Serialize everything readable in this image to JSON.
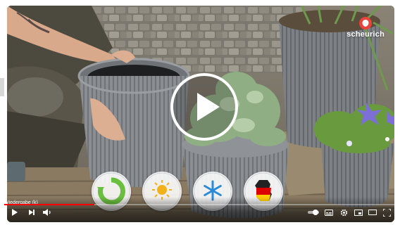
{
  "brand": {
    "logo_text": "scheurich"
  },
  "player": {
    "chapter_label": "Wiedergabe (k)",
    "progress": 0.23,
    "accent": "#ff0000",
    "icons": {
      "center": "play-icon",
      "play": "play-icon",
      "next": "next-icon",
      "volume": "volume-icon",
      "autoplay": "autoplay-toggle-icon",
      "subtitles": "subtitles-icon",
      "settings": "gear-icon",
      "miniplayer": "miniplayer-icon",
      "theater": "theater-mode-icon",
      "fullscreen": "fullscreen-icon"
    }
  },
  "badges": [
    {
      "icon": "recycle-icon",
      "color": "#6abf3f"
    },
    {
      "icon": "sun-icon",
      "color": "#f2b11b"
    },
    {
      "icon": "snowflake-icon",
      "color": "#2a8ad8"
    },
    {
      "icon": "germany-flag-icon",
      "color": "#dd0000"
    }
  ]
}
